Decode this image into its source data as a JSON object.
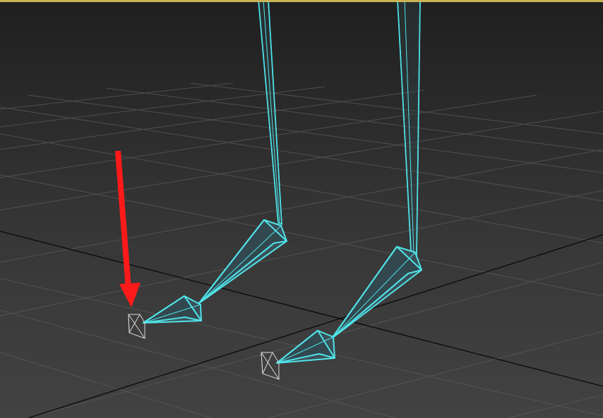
{
  "viewport": {
    "view": "perspective",
    "shading": "wireframe",
    "active": true
  },
  "colors": {
    "active_border": "#c9b458",
    "background_top": "#1f1f1f",
    "background_bottom": "#424242",
    "grid_line": "#5a5a5a",
    "grid_axis": "#0d0d0d",
    "bone_selected": "#4fe3e8",
    "bone_fill": "#3c5560",
    "bone_unselected": "#d6d6d6",
    "annotation_arrow": "#ff1a1a"
  },
  "scene": {
    "objects": [
      {
        "name": "left-thigh-bone",
        "selected": true
      },
      {
        "name": "left-calf-bone",
        "selected": true
      },
      {
        "name": "left-foot-bone",
        "selected": true
      },
      {
        "name": "left-toe-bone",
        "selected": true
      },
      {
        "name": "left-toe-nub",
        "selected": false
      },
      {
        "name": "right-thigh-bone",
        "selected": true
      },
      {
        "name": "right-calf-bone",
        "selected": true
      },
      {
        "name": "right-foot-bone",
        "selected": true
      },
      {
        "name": "right-toe-bone",
        "selected": true
      },
      {
        "name": "right-toe-nub",
        "selected": false
      }
    ],
    "annotation": {
      "type": "arrow",
      "points_to": "left-toe-nub"
    }
  }
}
